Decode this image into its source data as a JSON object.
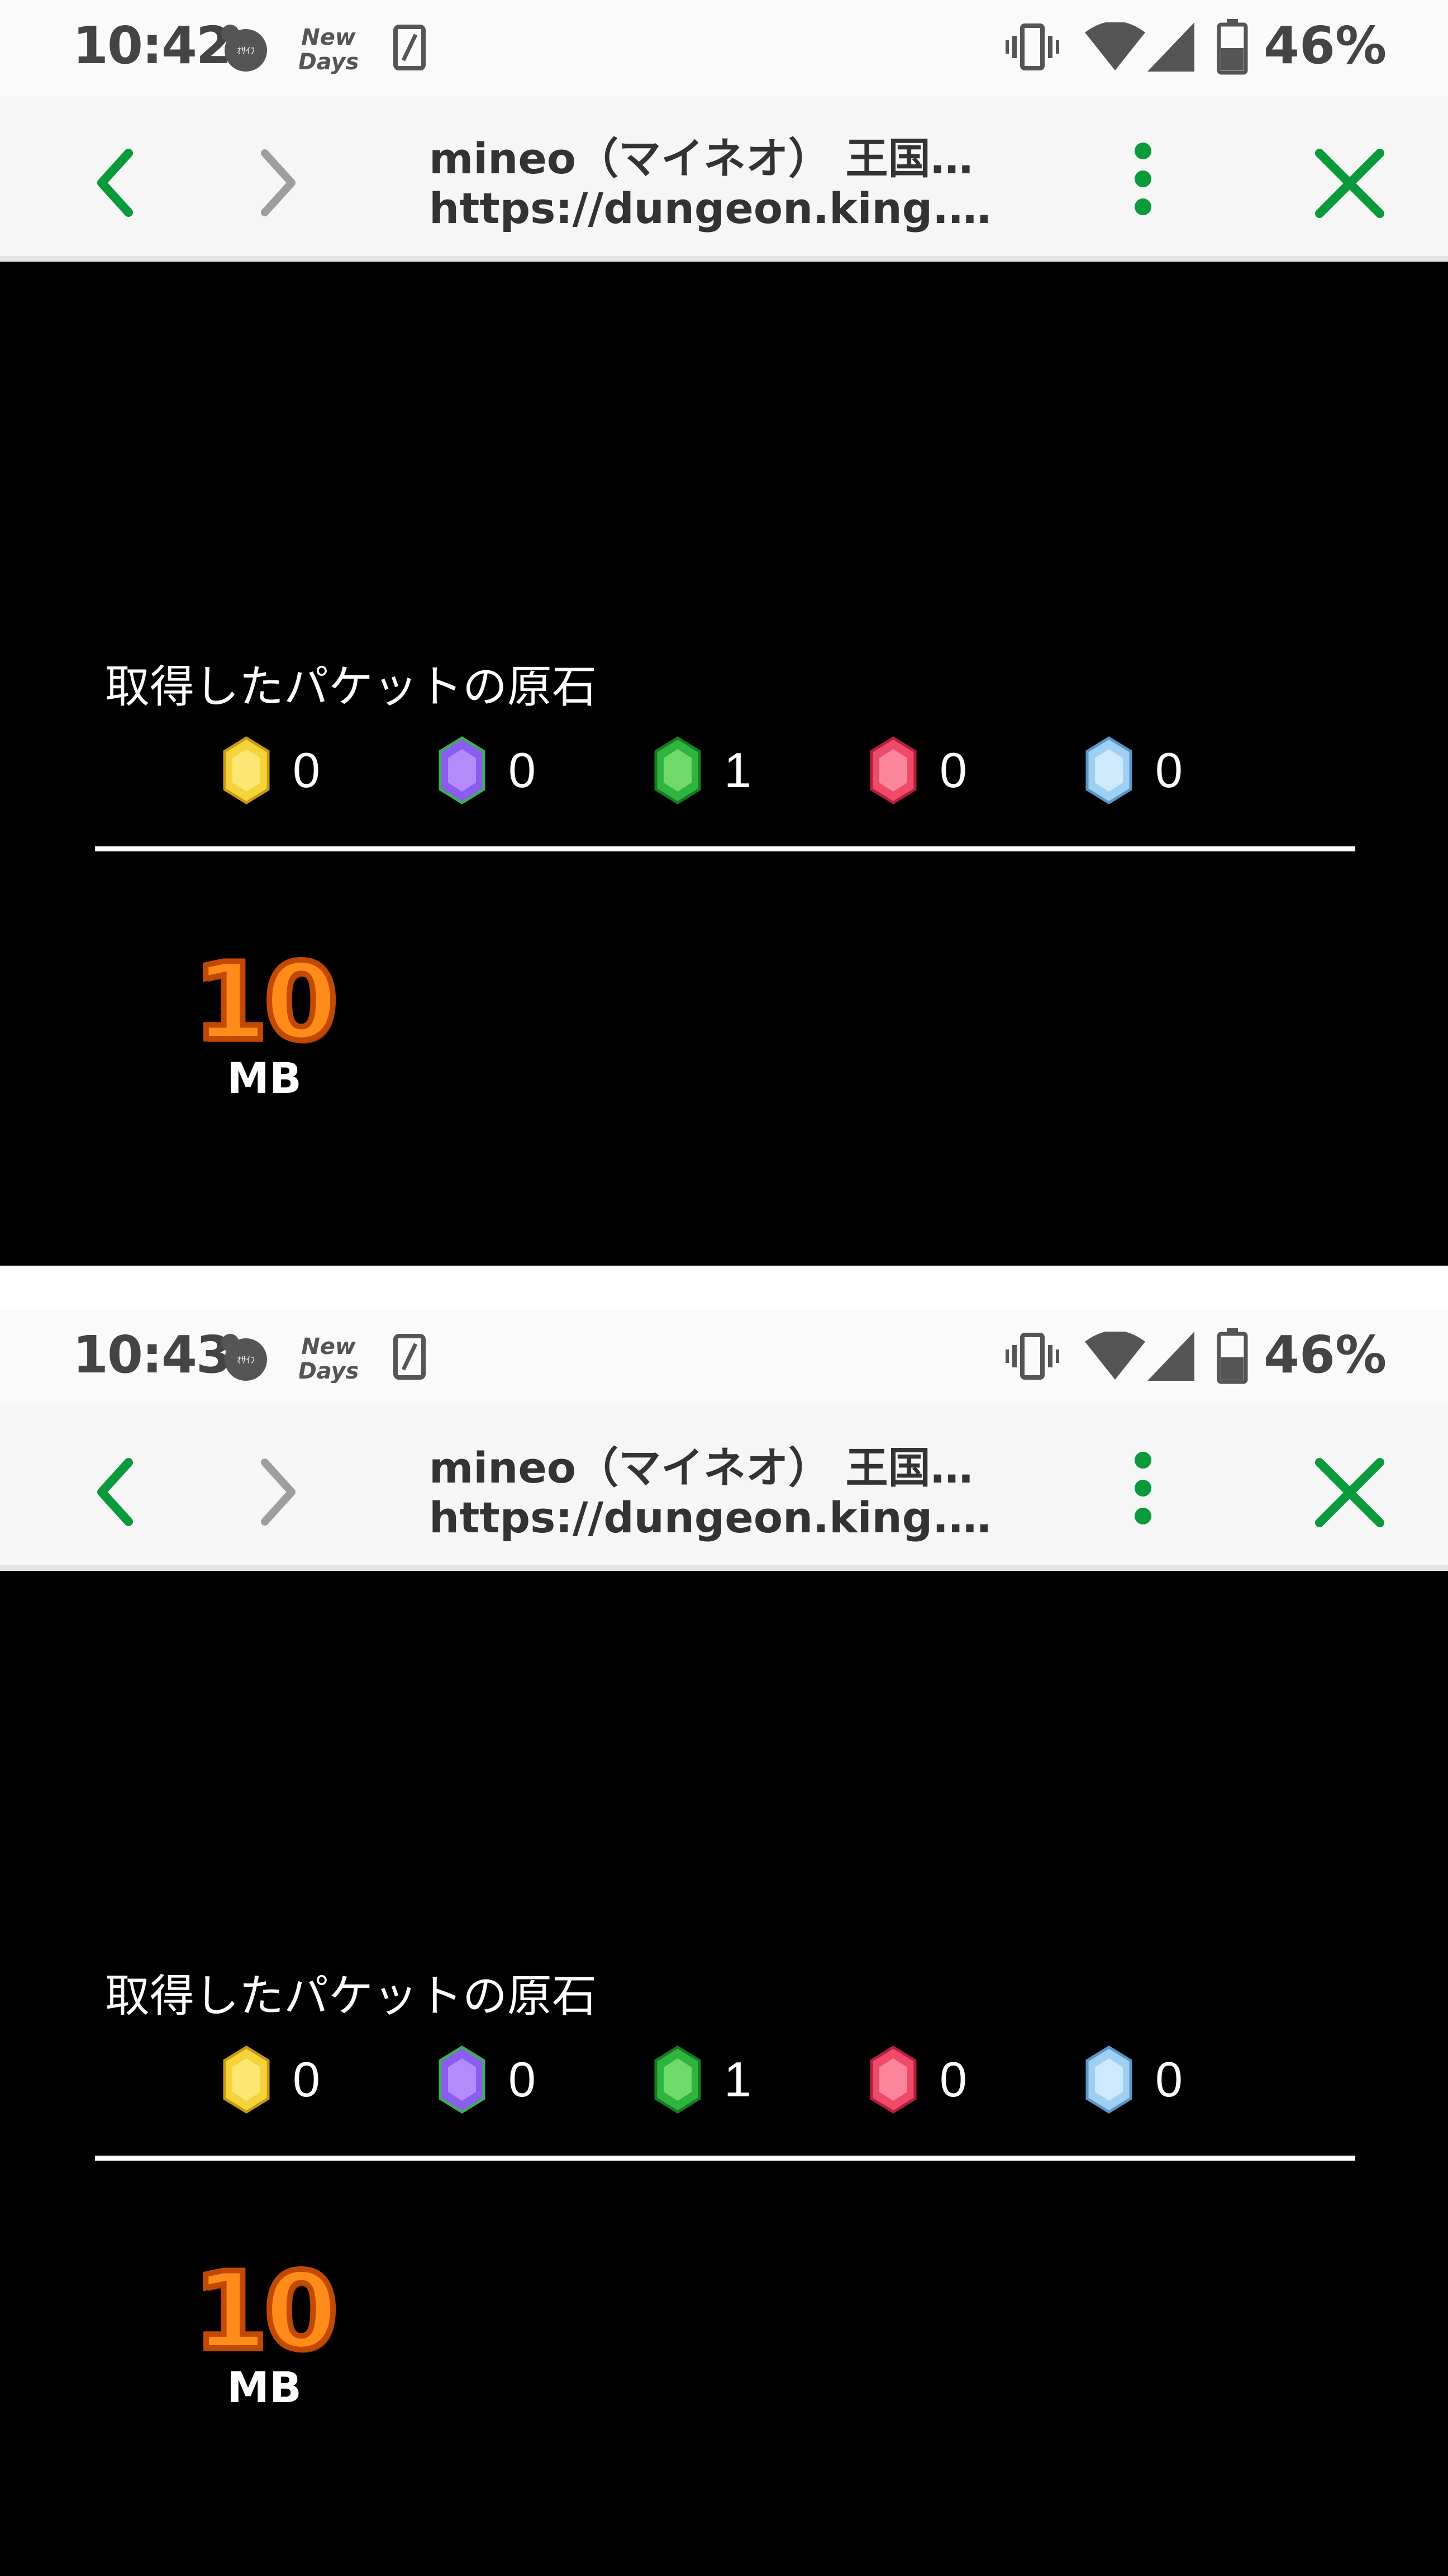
{
  "screens": [
    {
      "status": {
        "time": "10:42",
        "battery_percent": "46%"
      },
      "toolbar": {
        "title": "mineo（マイネオ） 王国ダ…",
        "url": "https://dungeon.king.mine…"
      },
      "game": {
        "heading": "取得したパケットの原石",
        "gems": [
          {
            "color": "yellow",
            "count": "0"
          },
          {
            "color": "purple",
            "count": "0"
          },
          {
            "color": "green",
            "count": "1"
          },
          {
            "color": "red",
            "count": "0"
          },
          {
            "color": "blue",
            "count": "0"
          }
        ],
        "packet_value": "10",
        "packet_unit": "MB"
      }
    },
    {
      "status": {
        "time": "10:43",
        "battery_percent": "46%"
      },
      "toolbar": {
        "title": "mineo（マイネオ） 王国ダ…",
        "url": "https://dungeon.king.mine…"
      },
      "game": {
        "heading": "取得したパケットの原石",
        "gems": [
          {
            "color": "yellow",
            "count": "0"
          },
          {
            "color": "purple",
            "count": "0"
          },
          {
            "color": "green",
            "count": "1"
          },
          {
            "color": "red",
            "count": "0"
          },
          {
            "color": "blue",
            "count": "0"
          }
        ],
        "packet_value": "10",
        "packet_unit": "MB"
      }
    }
  ],
  "status_icons": {
    "app_badge_1": "mascot-icon",
    "app_badge_2_text_top": "New",
    "app_badge_2_text_bottom": "Days",
    "others": [
      "sim-card-icon",
      "vibrate-icon",
      "wifi-icon",
      "cell-signal-icon",
      "battery-icon"
    ]
  },
  "toolbar_icons": [
    "back-arrow-icon",
    "forward-arrow-icon",
    "more-vert-icon",
    "close-icon"
  ],
  "colors": {
    "accent_green": "#0a9a3c",
    "disabled_gray": "#9e9e9e",
    "status_text": "#444444",
    "game_background": "#000000",
    "gem_yellow": "#f4d43a",
    "gem_purple": "#8a5cf0",
    "gem_green": "#2fb53f",
    "gem_red": "#f04a6a",
    "gem_blue": "#9fd0f4",
    "packet_orange": "#ff8c1a"
  }
}
